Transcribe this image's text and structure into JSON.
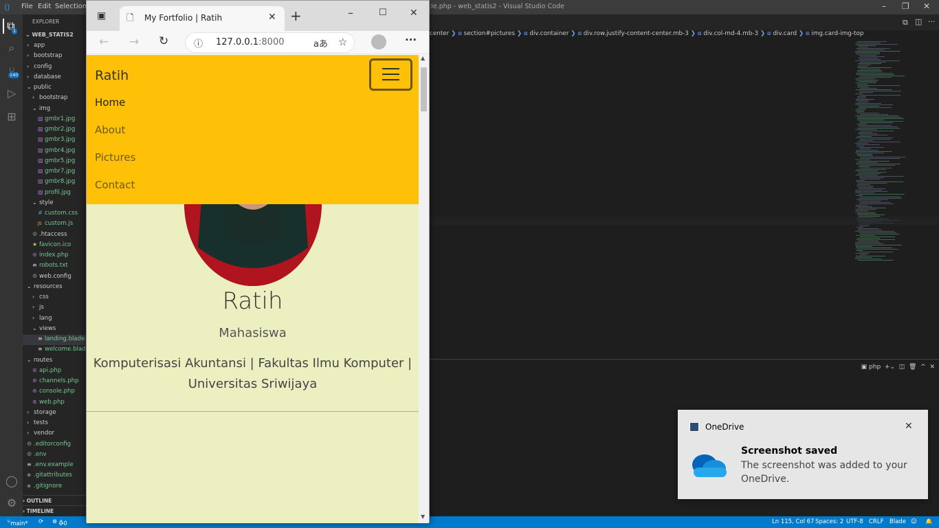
{
  "vscode": {
    "menu": [
      "File",
      "Edit",
      "Selection"
    ],
    "window_title": "cle.php - web_statis2 - Visual Studio Code",
    "explorer_title": "EXPLORER",
    "project": "WEB_STATIS2",
    "source_control_badge": "140",
    "explorer_badge": "1",
    "tree": [
      {
        "label": "app",
        "type": "folder",
        "open": false,
        "indent": 1
      },
      {
        "label": "bootstrap",
        "type": "folder",
        "open": false,
        "indent": 1
      },
      {
        "label": "config",
        "type": "folder",
        "open": false,
        "indent": 1
      },
      {
        "label": "database",
        "type": "folder",
        "open": false,
        "indent": 1
      },
      {
        "label": "public",
        "type": "folder",
        "open": true,
        "indent": 1
      },
      {
        "label": "bootstrap",
        "type": "folder",
        "open": false,
        "indent": 2
      },
      {
        "label": "img",
        "type": "folder",
        "open": true,
        "indent": 2
      },
      {
        "label": "gmbr1.jpg",
        "type": "image",
        "indent": 3
      },
      {
        "label": "gmbr2.jpg",
        "type": "image",
        "indent": 3
      },
      {
        "label": "gmbr3.jpg",
        "type": "image",
        "indent": 3
      },
      {
        "label": "gmbr4.jpg",
        "type": "image",
        "indent": 3
      },
      {
        "label": "gmbr5.jpg",
        "type": "image",
        "indent": 3
      },
      {
        "label": "gmbr7.jpg",
        "type": "image",
        "indent": 3
      },
      {
        "label": "gmbr8.jpg",
        "type": "image",
        "indent": 3
      },
      {
        "label": "profil.jpg",
        "type": "image",
        "indent": 3
      },
      {
        "label": "style",
        "type": "folder",
        "open": true,
        "indent": 2
      },
      {
        "label": "custom.css",
        "type": "css",
        "indent": 3
      },
      {
        "label": "custom.js",
        "type": "js",
        "indent": 3
      },
      {
        "label": ".htaccess",
        "type": "config",
        "indent": 2
      },
      {
        "label": "favicon.ico",
        "type": "star",
        "indent": 2
      },
      {
        "label": "index.php",
        "type": "php",
        "indent": 2
      },
      {
        "label": "robots.txt",
        "type": "text",
        "indent": 2
      },
      {
        "label": "web.config",
        "type": "config",
        "indent": 2
      },
      {
        "label": "resources",
        "type": "folder",
        "open": true,
        "indent": 1
      },
      {
        "label": "css",
        "type": "folder",
        "open": false,
        "indent": 2
      },
      {
        "label": "js",
        "type": "folder",
        "open": false,
        "indent": 2
      },
      {
        "label": "lang",
        "type": "folder",
        "open": false,
        "indent": 2
      },
      {
        "label": "views",
        "type": "folder",
        "open": true,
        "indent": 2
      },
      {
        "label": "landing.blade...",
        "type": "text",
        "indent": 3,
        "selected": true
      },
      {
        "label": "welcome.blad...",
        "type": "text",
        "indent": 3
      },
      {
        "label": "routes",
        "type": "folder",
        "open": true,
        "indent": 1
      },
      {
        "label": "api.php",
        "type": "php",
        "indent": 2
      },
      {
        "label": "channels.php",
        "type": "php",
        "indent": 2
      },
      {
        "label": "console.php",
        "type": "php",
        "indent": 2
      },
      {
        "label": "web.php",
        "type": "php",
        "indent": 2
      },
      {
        "label": "storage",
        "type": "folder",
        "open": false,
        "indent": 1
      },
      {
        "label": "tests",
        "type": "folder",
        "open": false,
        "indent": 1
      },
      {
        "label": "vendor",
        "type": "folder",
        "open": false,
        "indent": 1
      },
      {
        "label": ".editorconfig",
        "type": "config",
        "indent": 1
      },
      {
        "label": ".env",
        "type": "config",
        "indent": 1
      },
      {
        "label": ".env.example",
        "type": "text",
        "indent": 1
      },
      {
        "label": ".gitattributes",
        "type": "git",
        "indent": 1
      },
      {
        "label": ".gitignore",
        "type": "git",
        "indent": 1
      }
    ],
    "outline": "OUTLINE",
    "timeline": "TIMELINE",
    "breadcrumb": [
      "center",
      "section#pictures",
      "div.container",
      "div.row.justify-content-center.mb-3",
      "div.col-md-4.mb-3",
      "div.card",
      "img.card-img-top"
    ],
    "terminal_label": "php",
    "status": {
      "branch": "main*",
      "errors": "0",
      "warnings": "0",
      "position": "Ln 115, Col 67",
      "spaces": "Spaces: 2",
      "encoding": "UTF-8",
      "eol": "CRLF",
      "language": "Blade"
    }
  },
  "browser": {
    "tab_title": "My Fortfolio | Ratih",
    "url_host": "127.0.0.1",
    "url_port": ":8000",
    "read_aloud": "aあ"
  },
  "site": {
    "brand": "Ratih",
    "nav": [
      "Home",
      "About",
      "Pictures",
      "Contact"
    ],
    "active_nav": "Home",
    "name": "Ratih",
    "role": "Mahasiswa",
    "affiliation_line1": "Komputerisasi Akuntansi | Fakultas Ilmu Komputer |",
    "affiliation_line2": "Universitas Sriwijaya",
    "colors": {
      "navbar": "#ffc107",
      "page_bg": "#ecf0c0",
      "nav_text": "#6d5a22"
    }
  },
  "toast": {
    "app": "OneDrive",
    "title": "Screenshot saved",
    "body": "The screenshot was added to your OneDrive."
  }
}
